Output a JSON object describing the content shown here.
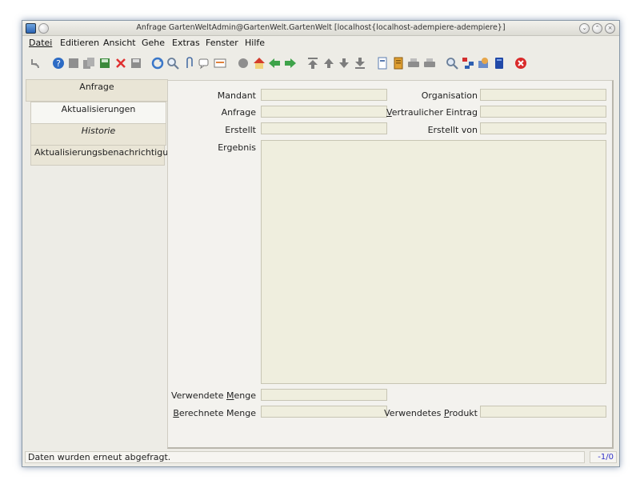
{
  "window": {
    "title": "Anfrage  GartenWeltAdmin@GartenWelt.GartenWelt [localhost{localhost-adempiere-adempiere}]"
  },
  "menu": [
    {
      "label": "Datei"
    },
    {
      "label": "Editieren"
    },
    {
      "label": "Ansicht"
    },
    {
      "label": "Gehe"
    },
    {
      "label": "Extras"
    },
    {
      "label": "Fenster"
    },
    {
      "label": "Hilfe"
    }
  ],
  "toolbar": {
    "icons": [
      "undo-icon",
      "help-icon",
      "new-record-icon",
      "copy-record-icon",
      "save-new-icon",
      "delete-icon",
      "save-icon",
      "refresh-icon",
      "find-icon",
      "attachment-icon",
      "chat-icon",
      "history-icon",
      "archive-icon",
      "home-icon",
      "back-icon",
      "forward-icon",
      "first-record-icon",
      "previous-record-icon",
      "next-record-icon",
      "last-record-icon",
      "report-icon",
      "print-preview-icon",
      "print-icon",
      "print-alt-icon",
      "zoom-across-icon",
      "workflow-icon",
      "product-info-icon",
      "request-icon",
      "close-icon"
    ]
  },
  "tabs": [
    {
      "label": "Anfrage"
    },
    {
      "label": "Aktualisierungen"
    },
    {
      "label": "Historie"
    },
    {
      "label": "Aktualisierungsbenachrichtigung"
    }
  ],
  "form": {
    "mandant_label": "Mandant",
    "organisation_label": "Organisation",
    "anfrage_label": "Anfrage",
    "vertraulicher_label_rest": "ertraulicher Eintrag",
    "vertraulicher_label_key": "V",
    "erstellt_label": "Erstellt",
    "erstellt_von_label": "Erstellt von",
    "ergebnis_label": "Ergebnis",
    "verwendete_menge_label_pre": "Verwendete ",
    "verwendete_menge_label_key": "M",
    "verwendete_menge_label_post": "enge",
    "berechnete_menge_label_key": "B",
    "berechnete_menge_label_post": "erechnete Menge",
    "verwendetes_produkt_label_pre": "Verwendetes ",
    "verwendetes_produkt_label_key": "P",
    "verwendetes_produkt_label_post": "rodukt"
  },
  "status": {
    "message": "Daten wurden erneut abgefragt.",
    "record_count": "-1/0"
  },
  "colors": {
    "window_bg": "#edece6",
    "field_bg": "#efeede",
    "count_text": "#3131c8"
  }
}
